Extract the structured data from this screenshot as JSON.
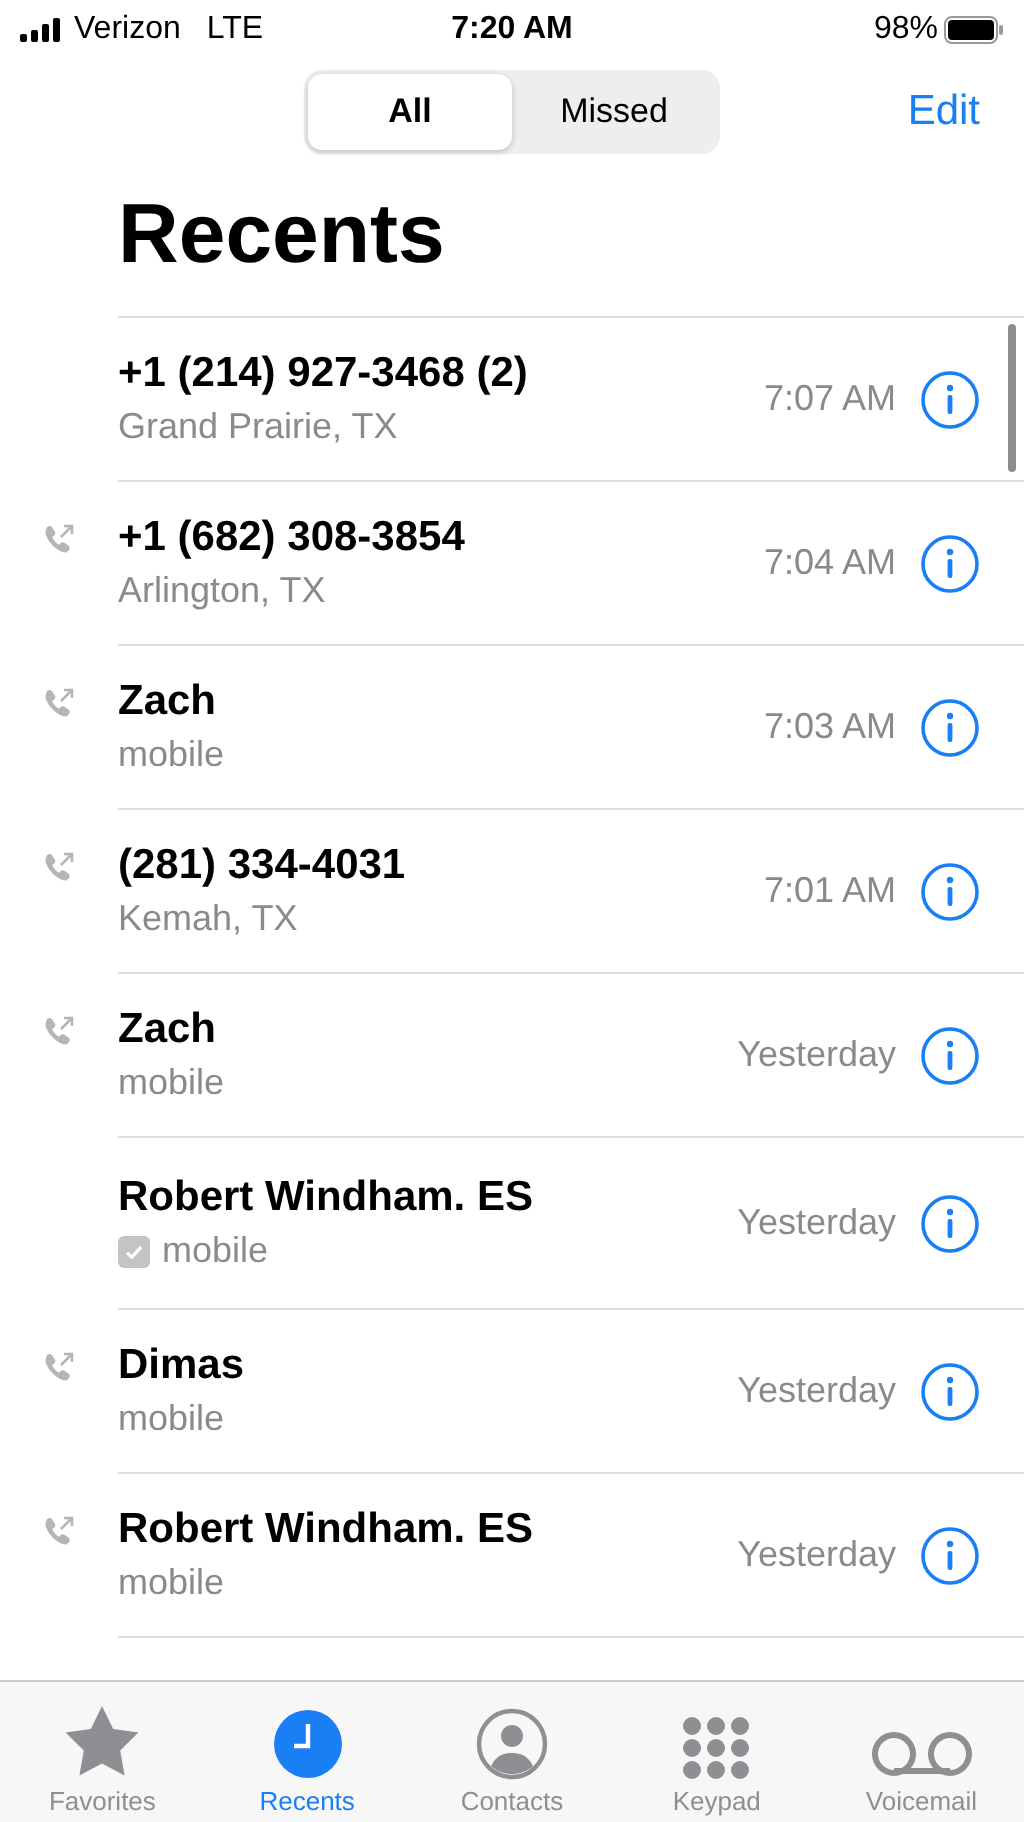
{
  "status_bar": {
    "carrier": "Verizon",
    "network": "LTE",
    "time": "7:20 AM",
    "battery": "98%"
  },
  "segments": [
    {
      "label": "All",
      "selected": true
    },
    {
      "label": "Missed",
      "selected": false
    }
  ],
  "edit": "Edit",
  "title": "Recents",
  "calls": [
    {
      "name": "+1 (214) 927-3468 (2)",
      "detail": "Grand Prairie, TX",
      "time": "7:07 AM",
      "outgoing": false,
      "verified": false
    },
    {
      "name": "+1 (682) 308-3854",
      "detail": "Arlington, TX",
      "time": "7:04 AM",
      "outgoing": true,
      "verified": false
    },
    {
      "name": "Zach",
      "detail": "mobile",
      "time": "7:03 AM",
      "outgoing": true,
      "verified": false
    },
    {
      "name": "(281) 334-4031",
      "detail": "Kemah, TX",
      "time": "7:01 AM",
      "outgoing": true,
      "verified": false
    },
    {
      "name": "Zach",
      "detail": "mobile",
      "time": "Yesterday",
      "outgoing": true,
      "verified": false
    },
    {
      "name": "Robert Windham. ES",
      "detail": "mobile",
      "time": "Yesterday",
      "outgoing": false,
      "verified": true
    },
    {
      "name": "Dimas",
      "detail": "mobile",
      "time": "Yesterday",
      "outgoing": true,
      "verified": false
    },
    {
      "name": "Robert Windham. ES",
      "detail": "mobile",
      "time": "Yesterday",
      "outgoing": true,
      "verified": false
    }
  ],
  "tabs": [
    {
      "kind": "star",
      "label": "Favorites",
      "selected": false
    },
    {
      "kind": "clock",
      "label": "Recents",
      "selected": true
    },
    {
      "kind": "person",
      "label": "Contacts",
      "selected": false
    },
    {
      "kind": "keypad",
      "label": "Keypad",
      "selected": false
    },
    {
      "kind": "voicemail",
      "label": "Voicemail",
      "selected": false
    }
  ]
}
